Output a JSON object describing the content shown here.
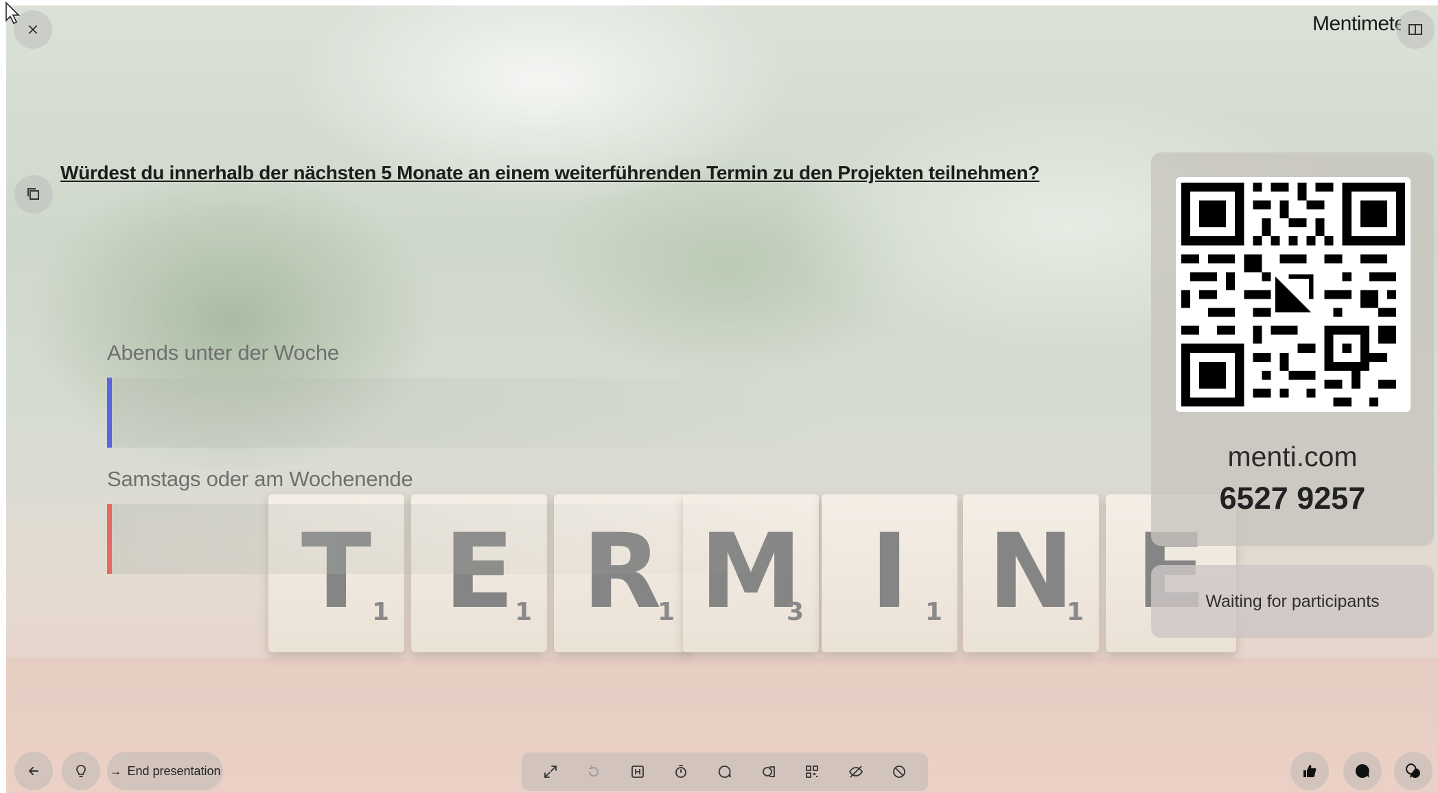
{
  "header": {
    "close_symbol": "×",
    "logo_text": "Mentimeter"
  },
  "question": {
    "title": "Würdest du innerhalb der nächsten 5 Monate an einem weiterführenden Termin zu den Projekten teilnehmen?"
  },
  "options": [
    {
      "label": "Abends unter der Woche",
      "color": "#5b63e0",
      "votes": 0
    },
    {
      "label": "Samstags oder am Wochenende",
      "color": "#e66a63",
      "votes": 0
    }
  ],
  "join_panel": {
    "domain": "menti.com",
    "code": "6527 9257"
  },
  "status": {
    "waiting_text": "Waiting for participants"
  },
  "bottom_bar": {
    "end_label": "End presentation",
    "tools": [
      "expand-icon",
      "reset-results-icon",
      "hide-heading-icon",
      "timer-icon",
      "comments-icon",
      "shapes-icon",
      "qr-code-icon",
      "hide-results-icon",
      "disable-voting-icon"
    ]
  },
  "background_tiles": [
    {
      "letter": "T",
      "points": "1"
    },
    {
      "letter": "E",
      "points": "1"
    },
    {
      "letter": "R",
      "points": "1"
    },
    {
      "letter": "M",
      "points": "3"
    },
    {
      "letter": "I",
      "points": "1"
    },
    {
      "letter": "N",
      "points": "1"
    },
    {
      "letter": "E",
      "points": ""
    }
  ],
  "colors": {
    "accent_blue": "#5b63e0",
    "accent_red": "#e66a63",
    "logo_red": "#e14b4b",
    "logo_navy": "#1f2b5c"
  }
}
